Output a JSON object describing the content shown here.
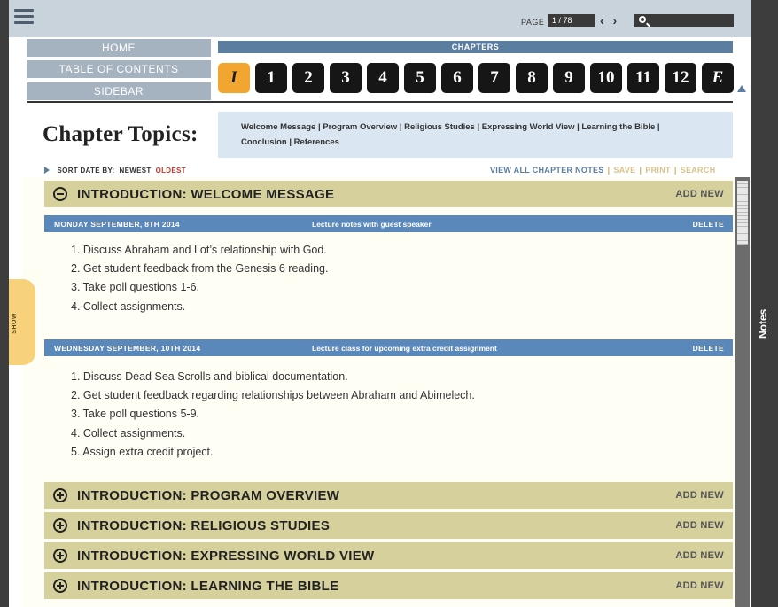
{
  "header": {
    "page_label": "PAGE",
    "page_value": "1 / 78",
    "nav_arrows": "‹ ›"
  },
  "nav": {
    "home": "HOME",
    "toc": "TABLE OF CONTENTS",
    "sidebar": "SIDEBAR"
  },
  "chapters": {
    "label": "CHAPTERS",
    "tabs": [
      "I",
      "1",
      "2",
      "3",
      "4",
      "5",
      "6",
      "7",
      "8",
      "9",
      "10",
      "11",
      "12",
      "E"
    ]
  },
  "topics": {
    "title": "Chapter Topics:",
    "line1": "Welcome Message  |  Program Overview  |  Religious Studies  |  Expressing World View  |  Learning the Bible  |",
    "line2": "Conclusion  |  References"
  },
  "sort": {
    "label": "SORT DATE BY:",
    "newest": "NEWEST",
    "oldest": "OLDEST"
  },
  "actions": {
    "view_all": "VIEW ALL CHAPTER NOTES",
    "save": "SAVE",
    "print": "PRINT",
    "search": "SEARCH"
  },
  "sections": [
    {
      "title": "INTRODUCTION: WELCOME MESSAGE",
      "add": "ADD NEW",
      "expanded": true
    },
    {
      "title": "INTRODUCTION: PROGRAM OVERVIEW",
      "add": "ADD NEW",
      "expanded": false
    },
    {
      "title": "INTRODUCTION: RELIGIOUS STUDIES",
      "add": "ADD NEW",
      "expanded": false
    },
    {
      "title": "INTRODUCTION: EXPRESSING WORLD VIEW",
      "add": "ADD NEW",
      "expanded": false
    },
    {
      "title": "INTRODUCTION: LEARNING THE BIBLE",
      "add": "ADD NEW",
      "expanded": false
    }
  ],
  "entries": [
    {
      "date": "MONDAY SEPTEMBER, 8TH 2014",
      "desc": "Lecture notes with guest speaker",
      "delete": "DELETE",
      "items": [
        "1. Discuss Abraham and Lot’s relationship with God.",
        "2. Get student feedback from the Genesis 6 reading.",
        "3. Take poll questions 1-6.",
        "4. Collect assignments."
      ]
    },
    {
      "date": "WEDNESDAY SEPTEMBER, 10TH 2014",
      "desc": "Lecture class for upcoming extra credit assignment",
      "delete": "DELETE",
      "items": [
        "1. Discuss Dead Sea Scrolls and biblical documentation.",
        "2. Get student feedback regarding relationships between Abraham and Abimelech.",
        "3. Take poll questions 5-9.",
        "4. Collect assignments.",
        "5. Assign extra credit project."
      ]
    }
  ],
  "side_tabs": {
    "show": "SHOW",
    "notes": "Notes"
  },
  "colors": {
    "accent_blue": "#5b7da0",
    "entry_blue": "#5b88ba",
    "section_khaki": "#d5d09c",
    "active_orange": "#f2a52f"
  }
}
